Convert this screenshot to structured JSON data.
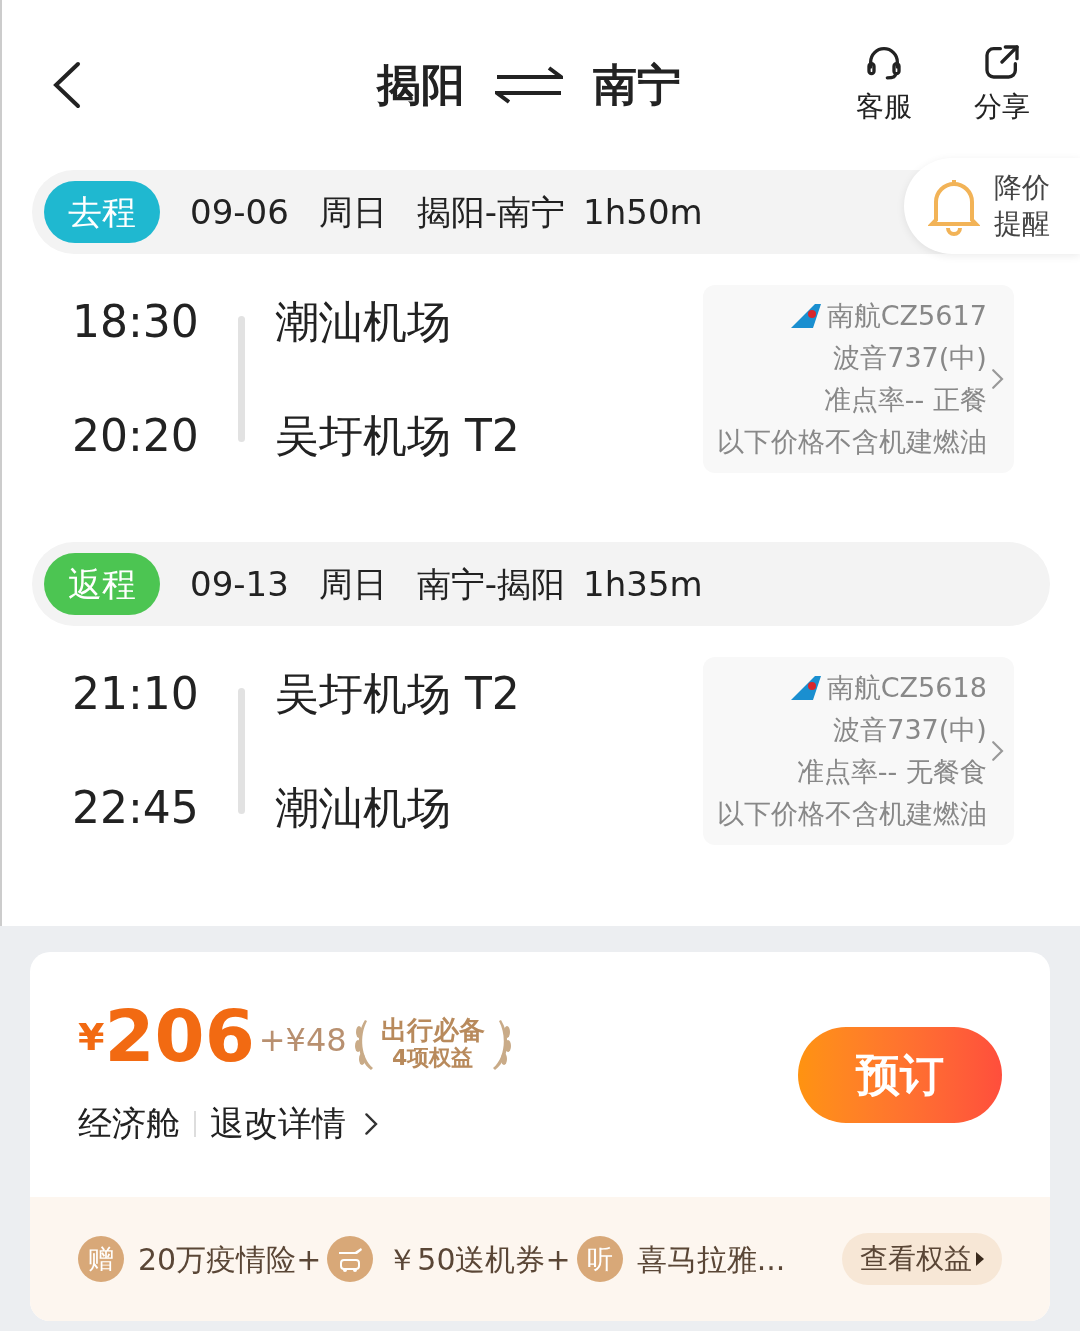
{
  "header": {
    "from": "揭阳",
    "to": "南宁",
    "actions": [
      {
        "kind": "service",
        "label": "客服"
      },
      {
        "kind": "share",
        "label": "分享"
      }
    ]
  },
  "price_alert": {
    "label": "降价提醒"
  },
  "segments": [
    {
      "tag": "去程",
      "color": "#1fb8d0",
      "date": "09-06",
      "weekday": "周日",
      "route": "揭阳-南宁",
      "duration": "1h50m",
      "departure_time": "18:30",
      "departure_airport": "潮汕机场",
      "arrival_time": "20:20",
      "arrival_airport": "吴圩机场 T2",
      "flight": {
        "number": "南航CZ5617",
        "aircraft": "波音737(中)",
        "info": "准点率-- 正餐",
        "note": "以下价格不含机建燃油"
      }
    },
    {
      "tag": "返程",
      "color": "#4cc552",
      "date": "09-13",
      "weekday": "周日",
      "route": "南宁-揭阳",
      "duration": "1h35m",
      "departure_time": "21:10",
      "departure_airport": "吴圩机场 T2",
      "arrival_time": "22:45",
      "arrival_airport": "潮汕机场",
      "flight": {
        "number": "南航CZ5618",
        "aircraft": "波音737(中)",
        "info": "准点率-- 无餐食",
        "note": "以下价格不含机建燃油"
      }
    }
  ],
  "price": {
    "currency": "¥",
    "amount": "206",
    "addon": "+¥48",
    "badge_title": "出行必备",
    "badge_subtitle": "4项权益",
    "cabin": "经济舱",
    "policy": "退改详情",
    "book_button": "预订"
  },
  "perks": [
    {
      "kind": "char",
      "badge": "赠",
      "text": "20万疫情险+"
    },
    {
      "kind": "icon",
      "text": "￥50送机券+"
    },
    {
      "kind": "char",
      "badge": "听",
      "text": "喜马拉雅..."
    }
  ],
  "perks_button": "查看权益"
}
